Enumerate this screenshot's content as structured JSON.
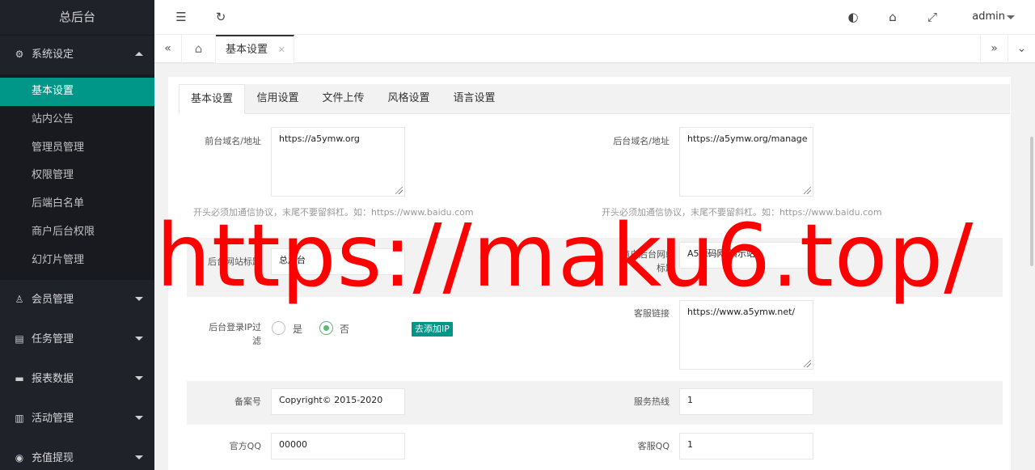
{
  "app": {
    "title": "总后台"
  },
  "sidebar": {
    "groups": [
      {
        "label": "系统设定",
        "icon": "gear-icon",
        "expanded": true,
        "items": [
          "基本设置",
          "站内公告",
          "管理员管理",
          "权限管理",
          "后端白名单",
          "商户后台权限",
          "幻灯片管理"
        ],
        "active": "基本设置"
      },
      {
        "label": "会员管理",
        "icon": "user-icon"
      },
      {
        "label": "任务管理",
        "icon": "document-icon"
      },
      {
        "label": "报表数据",
        "icon": "monitor-icon"
      },
      {
        "label": "活动管理",
        "icon": "book-icon"
      },
      {
        "label": "充值提现",
        "icon": "coin-icon"
      }
    ]
  },
  "header": {
    "user": "admin"
  },
  "tabbar": {
    "current_tab": "基本设置"
  },
  "settings": {
    "tabs": [
      "基本设置",
      "信用设置",
      "文件上传",
      "风格设置",
      "语言设置"
    ],
    "active_tab": "基本设置",
    "front_domain": {
      "label": "前台域名/地址",
      "value": "https://a5ymw.org",
      "hint": "开头必须加通信协议，末尾不要留斜杠。如：https://www.baidu.com"
    },
    "back_domain": {
      "label": "后台域名/地址",
      "value": "https://a5ymw.org/manage",
      "hint": "开头必须加通信协议，末尾不要留斜杠。如：https://www.baidu.com"
    },
    "back_site_title": {
      "label": "后台网站标题",
      "value": "总后台"
    },
    "merchant_title": {
      "label": "商户后台网站标题",
      "value": "A5源码网 演示站"
    },
    "ip_filter": {
      "label": "后台登录IP过滤",
      "options": [
        "是",
        "否"
      ],
      "selected": "否",
      "button": "去添加IP"
    },
    "service_link": {
      "label": "客服链接",
      "value": "https://www.a5ymw.net/"
    },
    "icp": {
      "label": "备案号",
      "value": "Copyright© 2015-2020"
    },
    "hotline": {
      "label": "服务热线",
      "value": "1"
    },
    "official_qq": {
      "label": "官方QQ",
      "value": "00000"
    },
    "service_qq": {
      "label": "客服QQ",
      "value": "1"
    }
  },
  "watermark": {
    "text": "https://maku6.top/"
  }
}
